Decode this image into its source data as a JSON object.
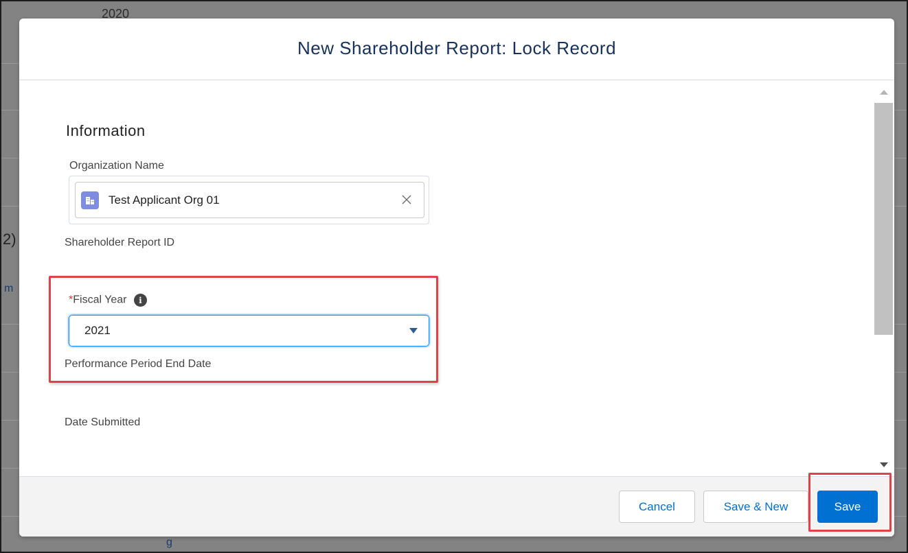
{
  "background": {
    "year_text": "2020",
    "paren_text": "2)",
    "fragment_m": "m",
    "fragment_g": "g"
  },
  "modal": {
    "title": "New Shareholder Report: Lock Record"
  },
  "form": {
    "section_title": "Information",
    "org_name_label": "Organization Name",
    "org_name_value": "Test Applicant Org 01",
    "shareholder_report_id_label": "Shareholder Report ID",
    "fiscal_year_required_mark": "*",
    "fiscal_year_label": "Fiscal Year",
    "fiscal_year_value": "2021",
    "performance_period_label": "Performance Period End Date",
    "date_submitted_label": "Date Submitted"
  },
  "footer": {
    "cancel_label": "Cancel",
    "save_new_label": "Save & New",
    "save_label": "Save"
  },
  "icons": {
    "org": "building-icon",
    "clear": "close-icon",
    "info": "info-icon",
    "dropdown": "chevron-down-icon"
  },
  "colors": {
    "brand": "#0070d2",
    "highlight": "#e0424b",
    "org_icon": "#7f8de1",
    "required": "#c23934"
  }
}
